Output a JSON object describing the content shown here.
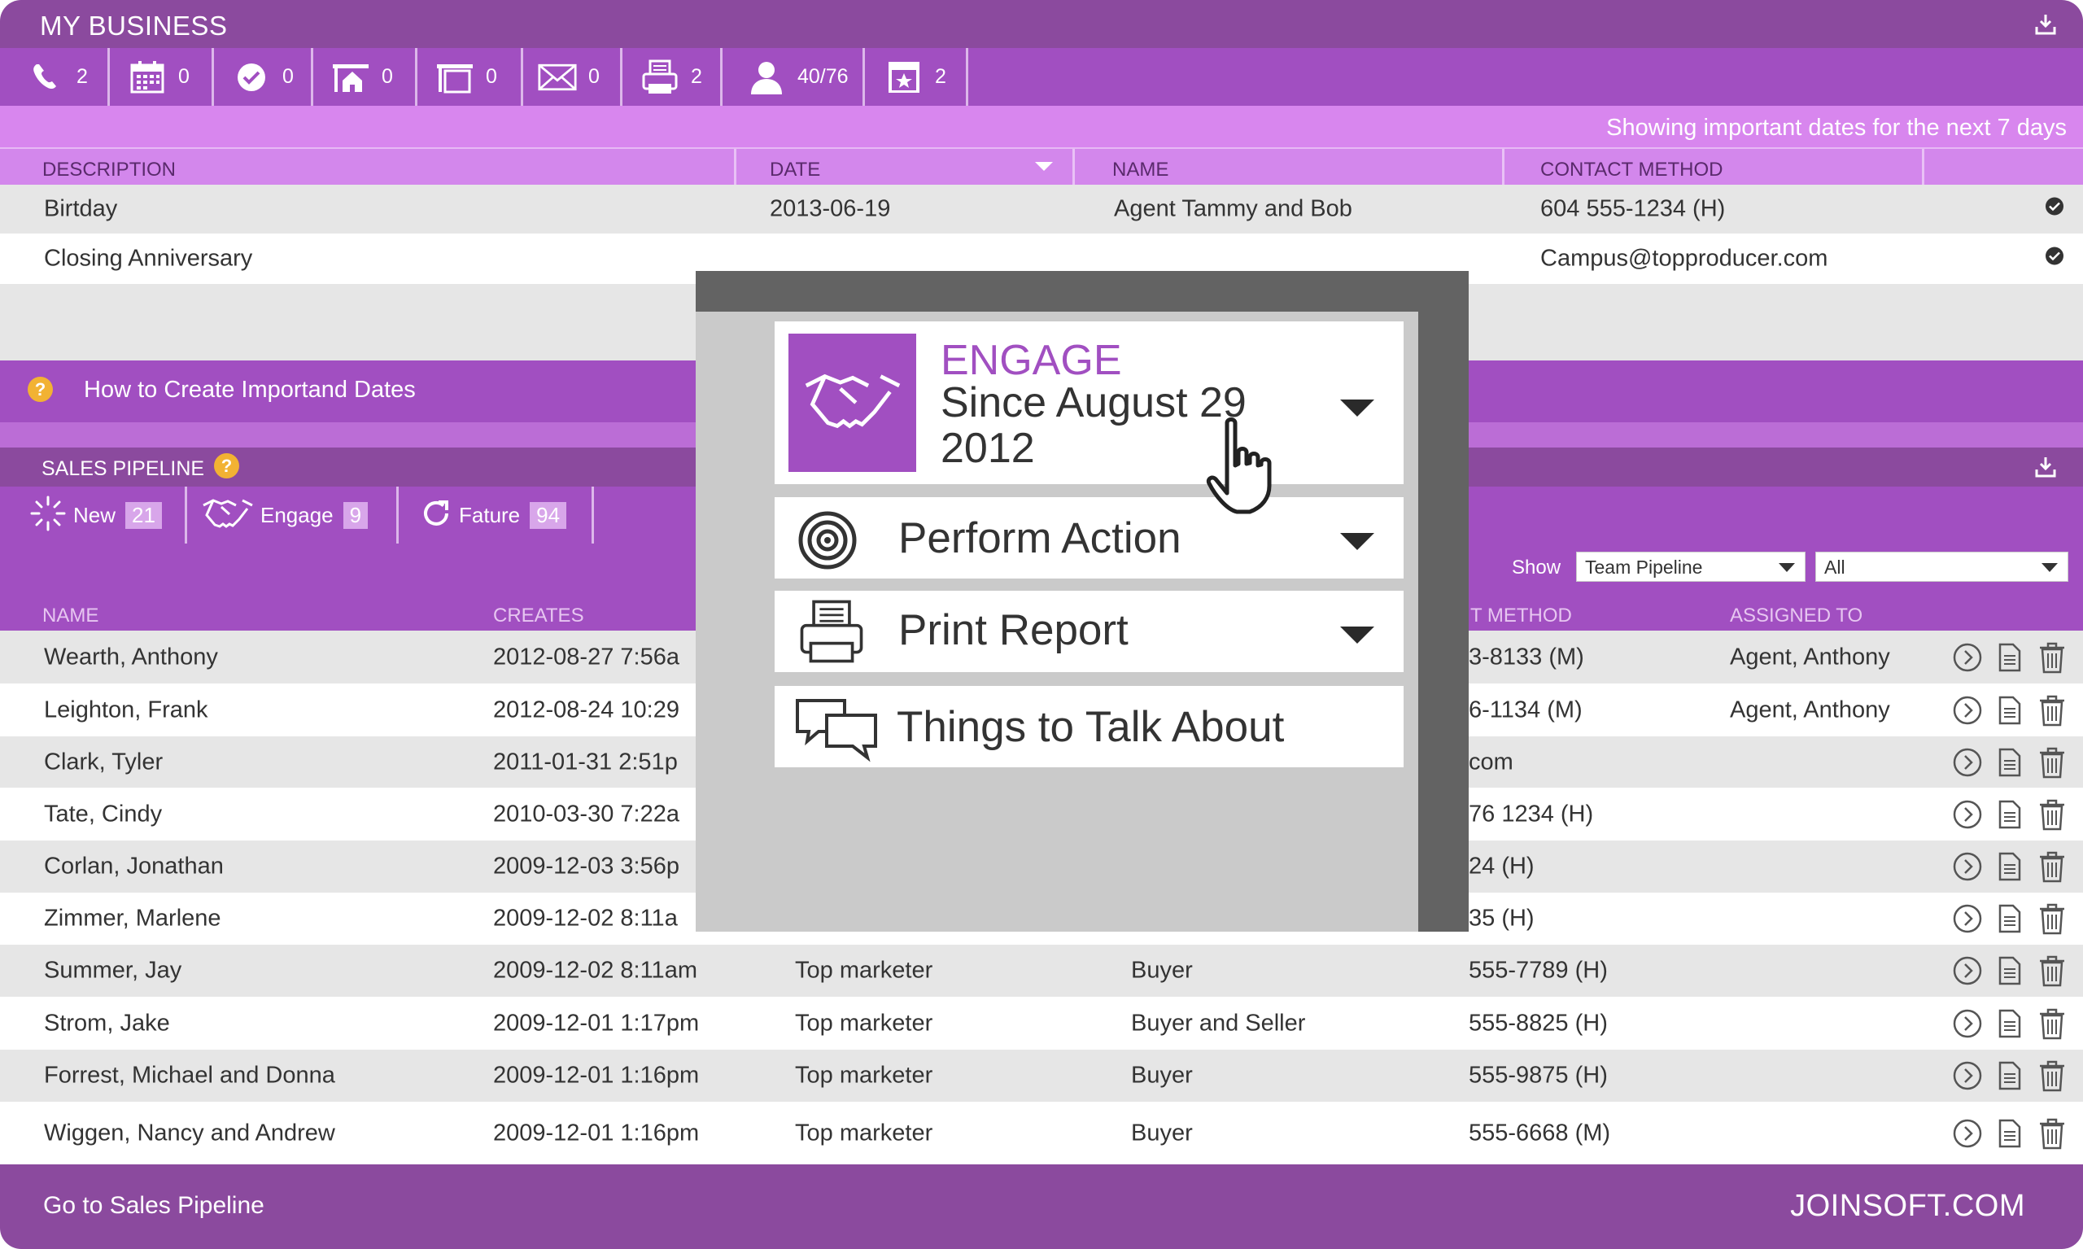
{
  "header": {
    "title": "MY BUSINESS"
  },
  "toolbar": {
    "items": [
      {
        "icon": "phone-icon",
        "count": "2"
      },
      {
        "icon": "calendar-icon",
        "count": "0"
      },
      {
        "icon": "check-icon",
        "count": "0"
      },
      {
        "icon": "house-icon",
        "count": "0"
      },
      {
        "icon": "folder-icon",
        "count": "0"
      },
      {
        "icon": "mail-icon",
        "count": "0"
      },
      {
        "icon": "printer-icon",
        "count": "2"
      },
      {
        "icon": "person-icon",
        "count": "40/76"
      },
      {
        "icon": "star-calendar-icon",
        "count": "2"
      }
    ]
  },
  "dates": {
    "notice": "Showing important dates for the next 7 days",
    "columns": [
      "DESCRIPTION",
      "DATE",
      "NAME",
      "CONTACT METHOD"
    ],
    "rows": [
      {
        "description": "Birtday",
        "date": "2013-06-19",
        "name": "Agent Tammy and Bob",
        "contact": "604 555-1234 (H)"
      },
      {
        "description": "Closing Anniversary",
        "date": "",
        "name": "",
        "contact": "Campus@topproducer.com"
      }
    ],
    "help": "How to Create Importand Dates"
  },
  "pipeline": {
    "title": "SALES PIPELINE",
    "stages": [
      {
        "label": "New",
        "count": "21"
      },
      {
        "label": "Engage",
        "count": "9"
      },
      {
        "label": "Fature",
        "count": "94"
      }
    ],
    "show_label": "Show",
    "filter1": "Team Pipeline",
    "filter2": "All",
    "columns": {
      "name": "NAME",
      "creates": "CREATES",
      "method": "T METHOD",
      "assigned": "ASSIGNED TO"
    },
    "rows": [
      {
        "name": "Wearth, Anthony",
        "created": "2012-08-27 7:56a",
        "source": "",
        "type": "",
        "contact": "3-8133 (M)",
        "assigned": "Agent, Anthony"
      },
      {
        "name": "Leighton, Frank",
        "created": "2012-08-24 10:29",
        "source": "",
        "type": "",
        "contact": "6-1134 (M)",
        "assigned": "Agent, Anthony"
      },
      {
        "name": "Clark, Tyler",
        "created": "2011-01-31 2:51p",
        "source": "",
        "type": "",
        "contact": "com",
        "assigned": ""
      },
      {
        "name": "Tate, Cindy",
        "created": "2010-03-30 7:22a",
        "source": "",
        "type": "",
        "contact": "76 1234 (H)",
        "assigned": ""
      },
      {
        "name": "Corlan, Jonathan",
        "created": "2009-12-03 3:56p",
        "source": "",
        "type": "",
        "contact": "24 (H)",
        "assigned": ""
      },
      {
        "name": "Zimmer, Marlene",
        "created": "2009-12-02 8:11a",
        "source": "",
        "type": "",
        "contact": "35 (H)",
        "assigned": ""
      },
      {
        "name": "Summer, Jay",
        "created": "2009-12-02 8:11am",
        "source": "Top marketer",
        "type": "Buyer",
        "contact": "555-7789 (H)",
        "assigned": ""
      },
      {
        "name": "Strom, Jake",
        "created": "2009-12-01 1:17pm",
        "source": "Top marketer",
        "type": "Buyer and Seller",
        "contact": "555-8825 (H)",
        "assigned": ""
      },
      {
        "name": "Forrest, Michael and Donna",
        "created": "2009-12-01 1:16pm",
        "source": "Top marketer",
        "type": "Buyer",
        "contact": "555-9875 (H)",
        "assigned": ""
      },
      {
        "name": "Wiggen, Nancy and Andrew",
        "created": "2009-12-01 1:16pm",
        "source": "Top marketer",
        "type": "Buyer",
        "contact": "555-6668 (M)",
        "assigned": ""
      }
    ]
  },
  "modal": {
    "engage_kicker": "ENGAGE",
    "engage_line1": "Since August 29",
    "engage_line2": "2012",
    "perform_action": "Perform Action",
    "print_report": "Print Report",
    "things_to_talk": "Things to Talk About"
  },
  "footer": {
    "go_link": "Go to Sales Pipeline",
    "brand": "JOINSOFT.COM"
  },
  "colors": {
    "purple_dark": "#8b4a9e",
    "purple": "#a14fc1",
    "purple_light": "#d886ee",
    "help_orange": "#f2b233"
  }
}
